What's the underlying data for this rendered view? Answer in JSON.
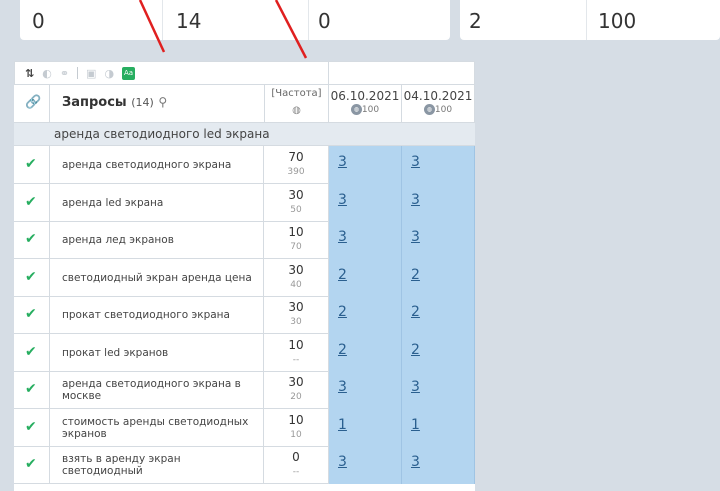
{
  "summary_cards": [
    {
      "value": "0"
    },
    {
      "value": "14"
    },
    {
      "value": "0"
    },
    {
      "value": "2"
    },
    {
      "value": "100"
    }
  ],
  "table": {
    "header": {
      "title": "Запросы",
      "count": "(14)",
      "freq_label": "[Частота]",
      "dates": [
        {
          "label": "06.10.2021",
          "sub": "100"
        },
        {
          "label": "04.10.2021",
          "sub": "100"
        }
      ]
    },
    "group_label": "аренда светодиодного led экрана",
    "rows": [
      {
        "query": "аренда светодиодного экрана",
        "freq": "70",
        "freq_sub": "390",
        "p1": "3",
        "p2": "3"
      },
      {
        "query": "аренда led экрана",
        "freq": "30",
        "freq_sub": "50",
        "p1": "3",
        "p2": "3"
      },
      {
        "query": "аренда лед экранов",
        "freq": "10",
        "freq_sub": "70",
        "p1": "3",
        "p2": "3"
      },
      {
        "query": "светодиодный экран аренда цена",
        "freq": "30",
        "freq_sub": "40",
        "p1": "2",
        "p2": "2"
      },
      {
        "query": "прокат светодиодного экрана",
        "freq": "30",
        "freq_sub": "30",
        "p1": "2",
        "p2": "2"
      },
      {
        "query": "прокат led экранов",
        "freq": "10",
        "freq_sub": "--",
        "p1": "2",
        "p2": "2"
      },
      {
        "query": "аренда светодиодного экрана в москве",
        "freq": "30",
        "freq_sub": "20",
        "p1": "3",
        "p2": "3"
      },
      {
        "query": "стоимость аренды светодиодных экранов",
        "freq": "10",
        "freq_sub": "10",
        "p1": "1",
        "p2": "1"
      },
      {
        "query": "взять в аренду экран светодиодный",
        "freq": "0",
        "freq_sub": "--",
        "p1": "3",
        "p2": "3"
      }
    ]
  },
  "colors": {
    "accent_green": "#27ae60",
    "position_cell": "#b3d5f0",
    "annotation": "#e02020"
  }
}
